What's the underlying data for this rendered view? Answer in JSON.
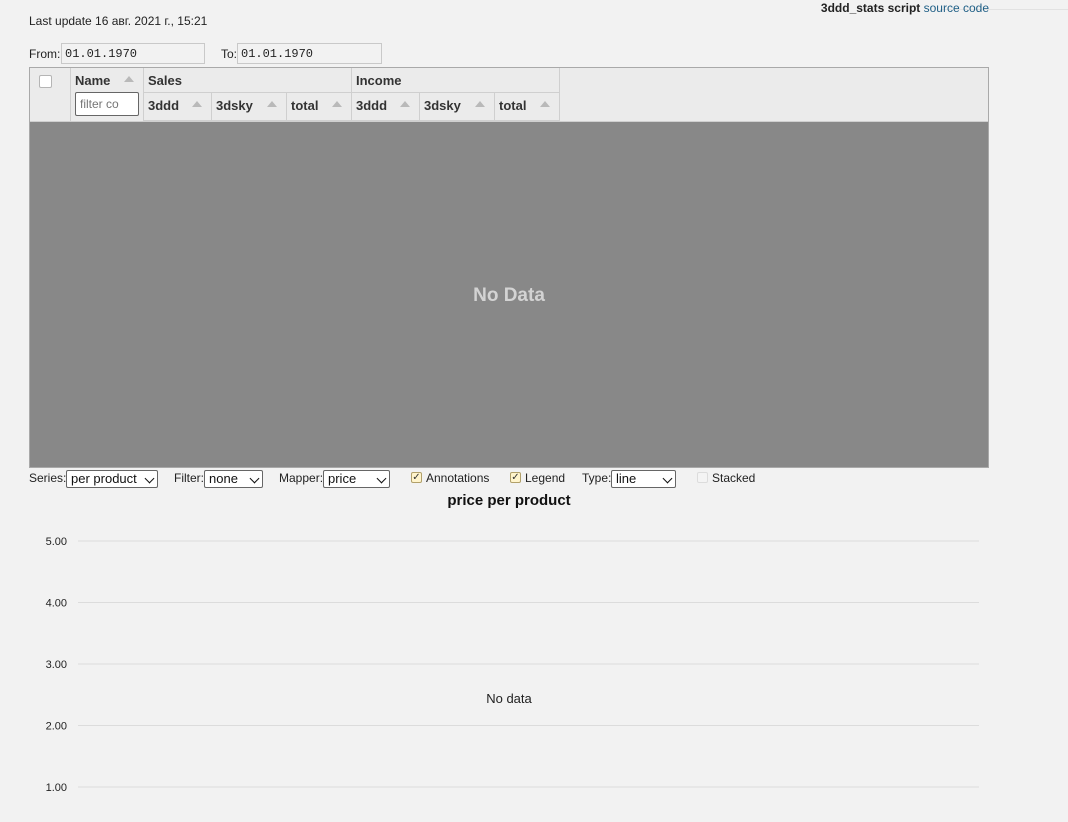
{
  "header": {
    "last_update": "Last update 16 авг. 2021 г., 15:21",
    "script_name": "3ddd_stats script",
    "source_link": "source code"
  },
  "date_range": {
    "from_label": "From:",
    "from_value": "01.01.1970",
    "to_label": "To:",
    "to_value": "01.01.1970"
  },
  "grid": {
    "columns": {
      "name": "Name",
      "name_filter_placeholder": "filter co",
      "sales_group": "Sales",
      "income_group": "Income",
      "sales_3ddd": "3ddd",
      "sales_3dsky": "3dsky",
      "sales_total": "total",
      "income_3ddd": "3ddd",
      "income_3dsky": "3dsky",
      "income_total": "total"
    },
    "empty_message": "No Data"
  },
  "controls": {
    "series_label": "Series:",
    "series_value": "per product",
    "filter_label": "Filter:",
    "filter_value": "none",
    "mapper_label": "Mapper:",
    "mapper_value": "price",
    "annotations_label": "Annotations",
    "annotations_checked": true,
    "legend_label": "Legend",
    "legend_checked": true,
    "type_label": "Type:",
    "type_value": "line",
    "stacked_label": "Stacked",
    "stacked_checked": false
  },
  "chart_data": {
    "type": "line",
    "title": "price per product",
    "empty_message": "No data",
    "ylim": [
      0.5,
      5.0
    ],
    "y_ticks": [
      5.0,
      4.0,
      3.0,
      2.0,
      1.0
    ],
    "y_tick_labels": [
      "5.00",
      "4.00",
      "3.00",
      "2.00",
      "1.00"
    ],
    "grid": true,
    "series": []
  }
}
